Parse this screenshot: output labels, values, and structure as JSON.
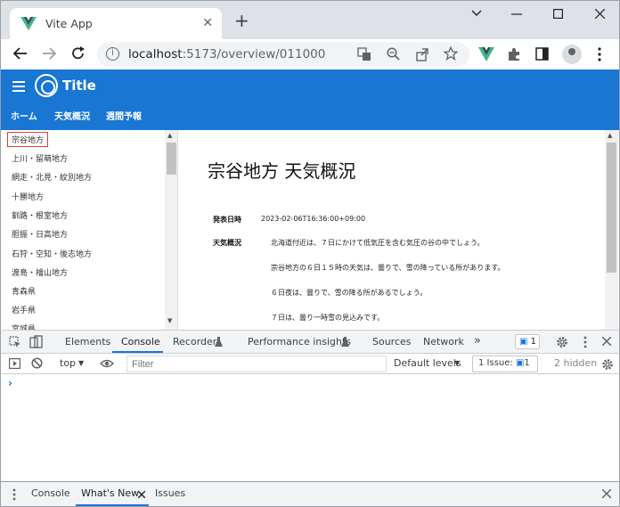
{
  "browser": {
    "tab_title": "Vite App",
    "tab_close": "✕",
    "new_tab": "+",
    "url_host": "localhost",
    "url_path": ":5173/overview/011000"
  },
  "app": {
    "title": "Title",
    "nav": [
      "ホーム",
      "天気概況",
      "週間予報"
    ]
  },
  "sidebar": {
    "items": [
      "宗谷地方",
      "上川・留萌地方",
      "網走・北見・紋別地方",
      "十勝地方",
      "釧路・根室地方",
      "胆振・日高地方",
      "石狩・空知・後志地方",
      "渡島・檜山地方",
      "青森県",
      "岩手県",
      "宮城県"
    ],
    "selected_index": 0
  },
  "main": {
    "title": "宗谷地方 天気概況",
    "published_label": "発表日時",
    "published_value": "2023-02-06T16:36:00+09:00",
    "overview_label": "天気概況",
    "overview_lines": [
      "北海道付近は、７日にかけて低気圧を含む気圧の谷の中でしょう。",
      "宗谷地方の６日１５時の天気は、曇りで、雪の降っている所があります。",
      "６日夜は、曇りで、雪の降る所があるでしょう。",
      "７日は、曇り一時雪の見込みです。"
    ]
  },
  "devtools": {
    "tabs": [
      "Elements",
      "Console",
      "Recorder",
      "Performance insights",
      "Sources",
      "Network"
    ],
    "more": "»",
    "issues_badge": "1",
    "context": "top",
    "filter_placeholder": "Filter",
    "levels": "Default levels",
    "issue_count": "1 Issue:",
    "issue_num": "1",
    "hidden": "2 hidden",
    "prompt": "›",
    "drawer_tabs": [
      "Console",
      "What's New",
      "Issues"
    ]
  },
  "colors": {
    "app_bar": "#1976d2",
    "accent": "#1a73e8",
    "selected_border": "#e53935",
    "vue_green": "#41b883"
  }
}
